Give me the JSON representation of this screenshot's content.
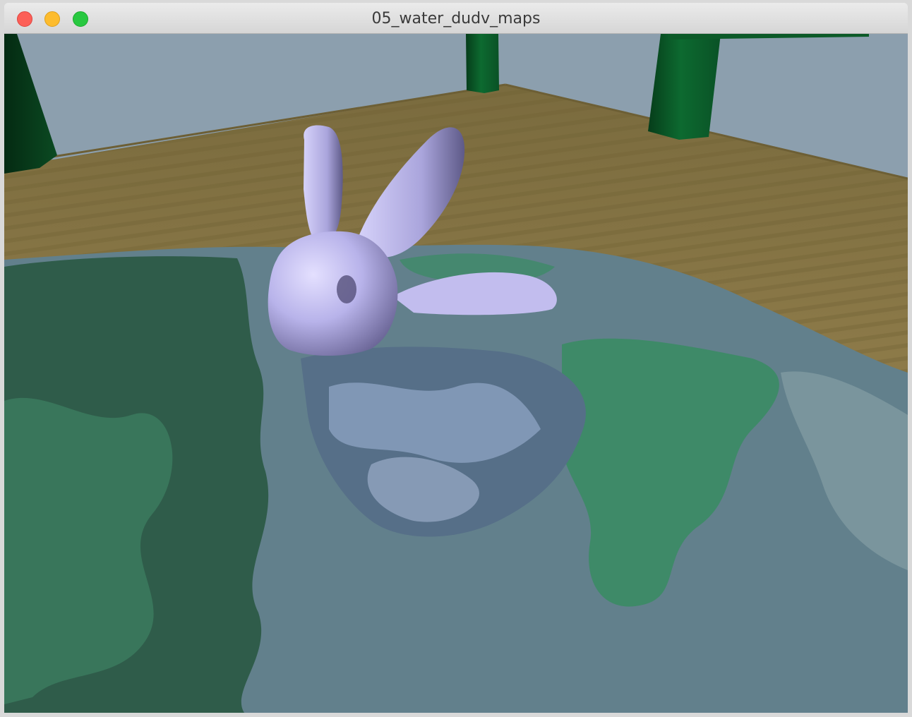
{
  "window": {
    "title": "05_water_dudv_maps"
  },
  "controls": {
    "close_icon": "close-icon",
    "minimize_icon": "minimize-icon",
    "zoom_icon": "zoom-icon"
  },
  "colors": {
    "sky": "#8c9fae",
    "ground": "#8c7a48",
    "water_dark": "#2f5848",
    "water_green": "#3e8a68",
    "water_grey": "#62808c",
    "bunny": "#b4b0e6",
    "tree_trunk": "#0a5a28",
    "close": "#fc5f57",
    "minimize": "#fdbc2e",
    "zoom": "#28c840"
  }
}
